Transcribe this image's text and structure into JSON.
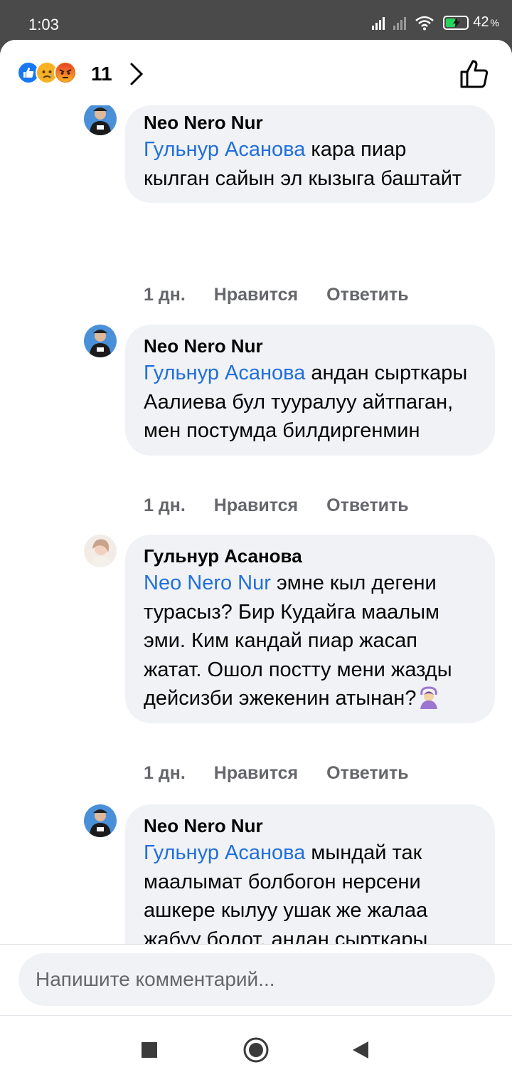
{
  "status": {
    "time": "1:03",
    "battery": "42",
    "battery_unit": "%",
    "battery_color": "#27d35a"
  },
  "reactions": {
    "icons": [
      "like-icon",
      "sad-icon",
      "angry-icon"
    ],
    "count": "11"
  },
  "comments": [
    {
      "author": "Neo Nero Nur",
      "mention": "Гульнур Асанова",
      "text": " кара пиар кылган сайын эл кызыга баштайт",
      "time": "1 дн.",
      "like_label": "Нравится",
      "reply_label": "Ответить"
    },
    {
      "author": "Neo Nero Nur",
      "mention": "Гульнур Асанова",
      "text": " андан сырткары Аалиева бул тууралуу айтпаган, мен постумда билдиргенмин",
      "time": "1 дн.",
      "like_label": "Нравится",
      "reply_label": "Ответить"
    },
    {
      "author": "Гульнур Асанова",
      "mention": "Neo Nero Nur",
      "text": " эмне кыл дегени турасыз? Бир Кудайга маалым эми. Ким кандай пиар жасап жатат. Ошол постту мени жазды дейсизби эжекенин атынан?",
      "time": "1 дн.",
      "like_label": "Нравится",
      "reply_label": "Ответить"
    },
    {
      "author": "Neo Nero Nur",
      "mention": "Гульнур Асанова",
      "text": " мындай так маалымат болбогон нерсени ашкере кылуу ушак же жалаа жабуу болот, андан сырткары интим фантазияларды"
    }
  ],
  "input": {
    "placeholder": "Напишите комментарий..."
  },
  "colors": {
    "mention": "#216fdb",
    "bubble": "#f0f2f5",
    "like_reaction": "#1877f2"
  }
}
